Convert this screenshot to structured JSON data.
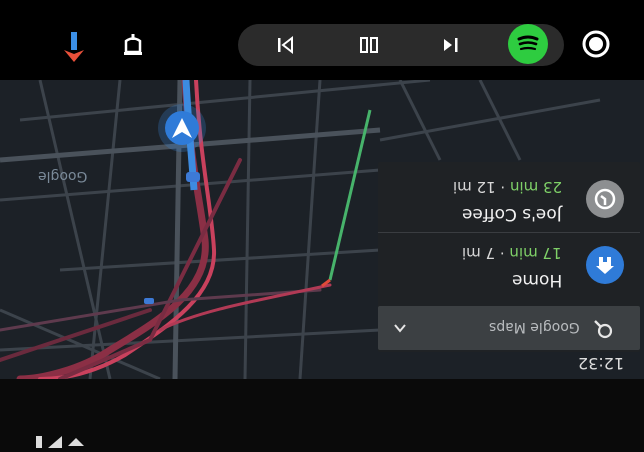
{
  "topbar": {
    "icons": {
      "navigation": "navigation-arrow-icon",
      "shield": "shield-icon",
      "previous": "skip-previous-icon",
      "pause": "pause-icon",
      "next": "skip-next-icon",
      "spotify": "spotify-icon",
      "home": "home-circle-icon"
    },
    "colors": {
      "spotify": "#2ecc40",
      "navigation_accent": "#e8503a"
    }
  },
  "map": {
    "watermark": "Google",
    "clock": "12:32",
    "settings_icon": "gear-icon"
  },
  "suggestions": [
    {
      "title": "Joe's Coffee",
      "eta": "23 min",
      "separator": " · ",
      "distance": "12 mi",
      "icon": "history-icon",
      "color": "#8d8f91"
    },
    {
      "title": "Home",
      "eta": "17 min",
      "separator": " · ",
      "distance": "7 mi",
      "icon": "home-icon",
      "color": "#2f7bd8"
    }
  ],
  "search": {
    "label": "Google Maps",
    "icon": "search-icon",
    "expand_icon": "chevron-down-icon"
  }
}
